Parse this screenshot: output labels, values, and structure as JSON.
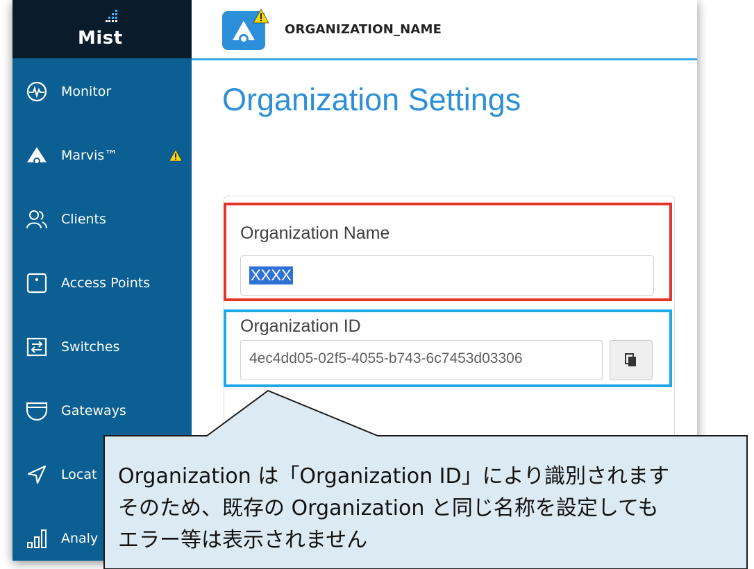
{
  "app": {
    "logo_text": "Mist"
  },
  "header": {
    "org_name": "ORGANIZATION_NAME"
  },
  "page": {
    "title": "Organization Settings"
  },
  "sidebar": {
    "items": [
      {
        "label": "Monitor",
        "icon": "monitor-icon"
      },
      {
        "label": "Marvis™",
        "icon": "marvis-icon",
        "warning": true
      },
      {
        "label": "Clients",
        "icon": "clients-icon"
      },
      {
        "label": "Access Points",
        "icon": "access-point-icon"
      },
      {
        "label": "Switches",
        "icon": "switch-icon"
      },
      {
        "label": "Gateways",
        "icon": "gateway-icon"
      },
      {
        "label": "Locat",
        "icon": "location-icon"
      },
      {
        "label": "Analy",
        "icon": "analytics-icon"
      }
    ]
  },
  "form": {
    "org_name_label": "Organization Name",
    "org_name_value": "XXXX",
    "org_id_label": "Organization ID",
    "org_id_value": "4ec4dd05-02f5-4055-b743-6c7453d03306"
  },
  "callout": {
    "lines": [
      "Organization は「Organization ID」により識別されます",
      "そのため、既存の Organization と同じ名称を設定しても",
      "エラー等は表示されません"
    ]
  },
  "colors": {
    "sidebar": "#0b5f93",
    "logo_bg": "#0a1b2c",
    "accent": "#2d8fd6",
    "highlight_red": "#e3362b",
    "highlight_blue": "#1fa8e8",
    "callout_bg": "#dcebf3"
  }
}
